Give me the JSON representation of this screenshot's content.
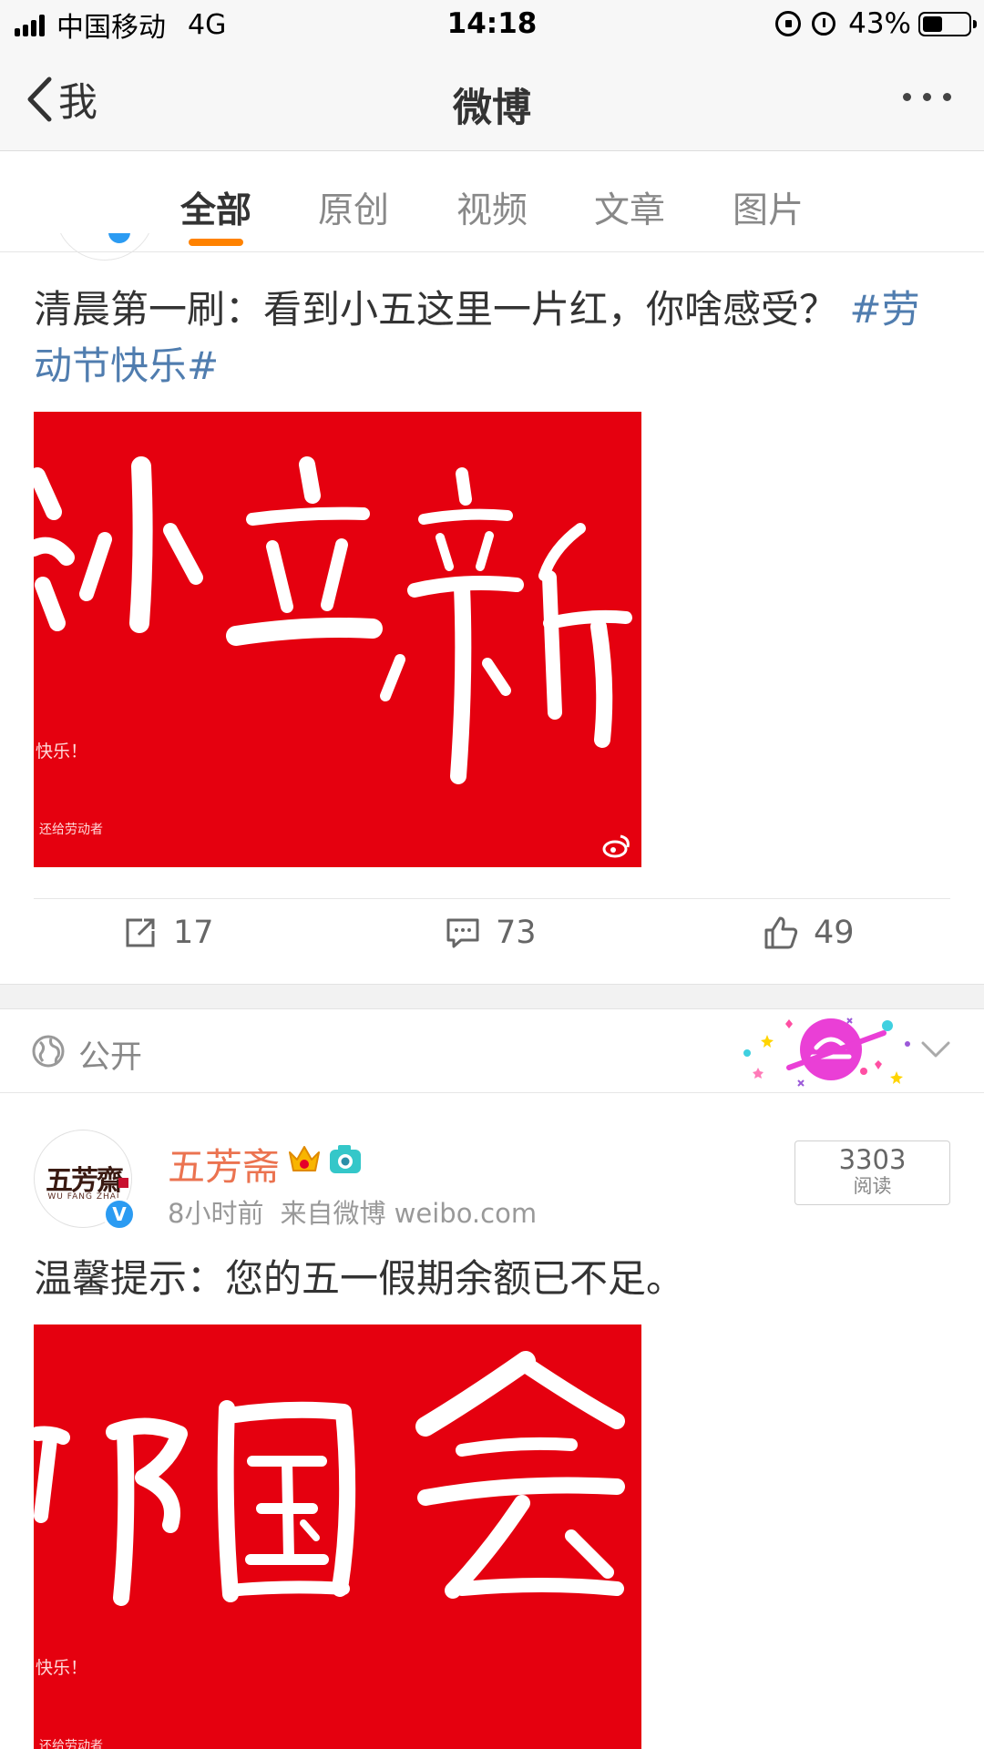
{
  "status_bar": {
    "carrier": "中国移动",
    "network": "4G",
    "time": "14:18",
    "battery_percent": "43%",
    "battery_level": 0.43,
    "icons": [
      "signal-icon",
      "rotation-lock-icon",
      "alarm-icon",
      "battery-icon"
    ]
  },
  "nav": {
    "back_label": "我",
    "title": "微博",
    "more_icon": "more-icon"
  },
  "tabs": [
    {
      "label": "全部",
      "active": true
    },
    {
      "label": "原创",
      "active": false
    },
    {
      "label": "视频",
      "active": false
    },
    {
      "label": "文章",
      "active": false
    },
    {
      "label": "图片",
      "active": false
    }
  ],
  "posts": [
    {
      "text": "清晨第一刷：看到小五这里一片红，你啥感受？",
      "hashtag": "#劳动节快乐#",
      "image": {
        "background": "#e5000f",
        "caption_lines": [
          "快乐！",
          "还给劳动者"
        ]
      },
      "reposts": "17",
      "comments": "73",
      "likes": "49"
    },
    {
      "visibility": "公开",
      "author": "五芳斋",
      "avatar_text": "五芳齋",
      "avatar_subtext": "WU FANG ZHAI",
      "time": "8小时前",
      "source": "来自微博 weibo.com",
      "read_count": "3303",
      "read_label": "阅读",
      "text": "温馨提示：您的五一假期余额已不足。",
      "image": {
        "background": "#e5000f",
        "caption_lines": [
          "快乐！",
          "还给劳动者"
        ]
      }
    }
  ],
  "colors": {
    "accent_orange": "#ff8200",
    "author_name": "#eb7350",
    "hashtag_blue": "#507daf",
    "verified_blue": "#2b9bf2",
    "image_red": "#e5000f"
  }
}
